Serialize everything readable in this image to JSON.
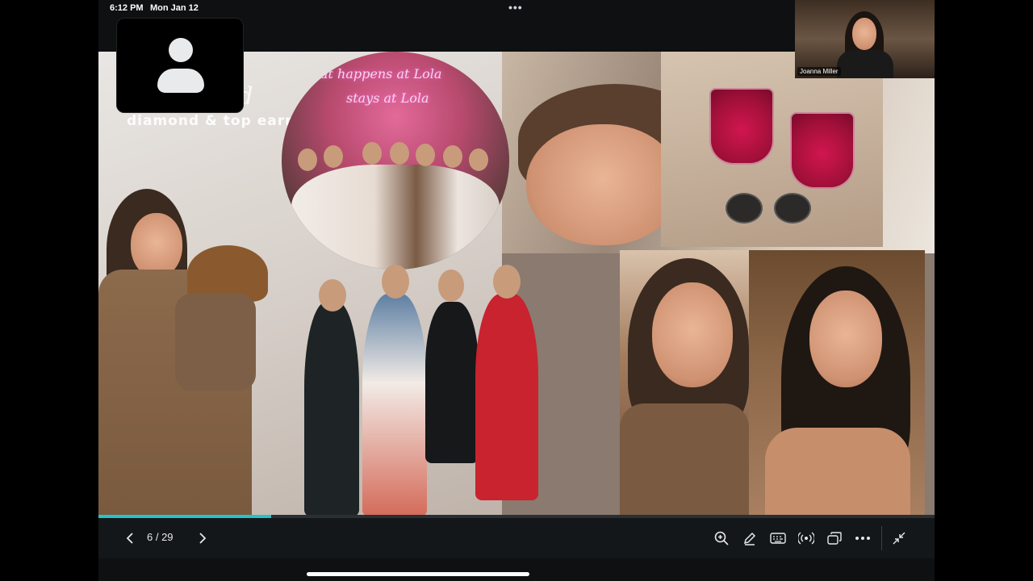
{
  "status_bar": {
    "time": "6:12 PM",
    "date": "Mon Jan 12",
    "more_icon": "ellipsis-icon"
  },
  "slide": {
    "script_name": "annd",
    "subtitle": "diamond & top earner",
    "neon_line1": "at happens at Lola",
    "neon_line2": "stays at Lola"
  },
  "participants": {
    "self_tile_icon": "person-icon",
    "remote_name": "Joanna Miller"
  },
  "presentation": {
    "page_counter": "6 / 29",
    "progress": 0.207
  },
  "toolbar": {
    "prev_icon": "chevron-left-icon",
    "next_icon": "chevron-right-icon",
    "zoom_icon": "zoom-in-icon",
    "annotate_icon": "pen-icon",
    "keyboard_icon": "keyboard-icon",
    "broadcast_icon": "broadcast-icon",
    "layout_icon": "window-switch-icon",
    "more_icon": "ellipsis-icon",
    "minimize_icon": "minimize-icon"
  },
  "colors": {
    "accent": "#27c2c9",
    "background": "#0e1012",
    "toolbar": "#141719"
  }
}
